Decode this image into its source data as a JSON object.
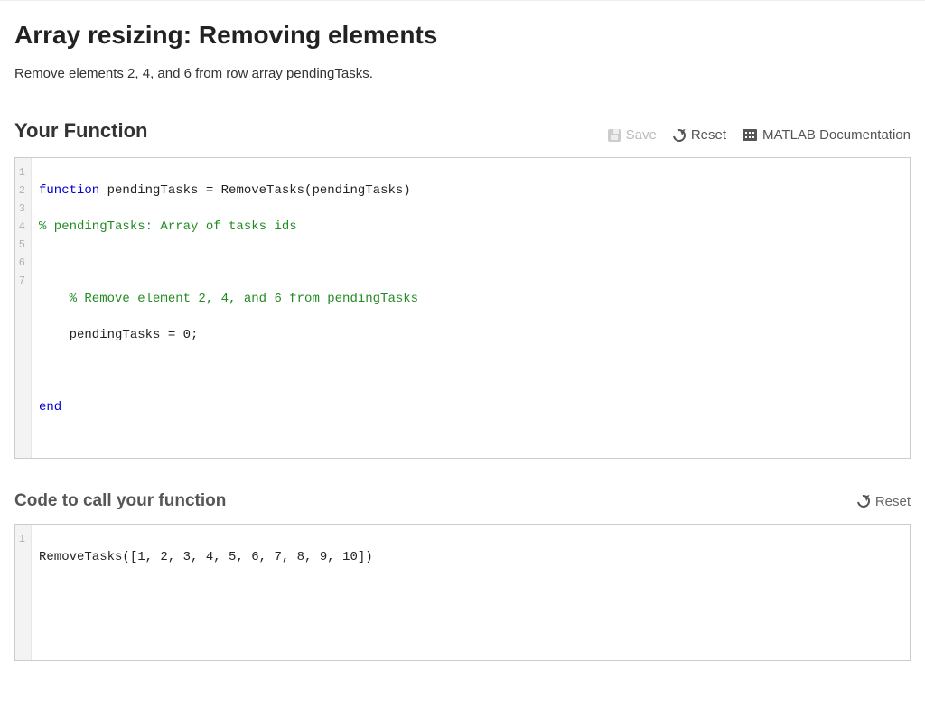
{
  "title": "Array resizing: Removing elements",
  "instruction": "Remove elements 2, 4, and 6 from row array pendingTasks.",
  "section1": {
    "heading": "Your Function",
    "actions": {
      "save": "Save",
      "reset": "Reset",
      "docs": "MATLAB Documentation"
    }
  },
  "editor1": {
    "gutter": [
      "1",
      "2",
      "3",
      "4",
      "5",
      "6",
      "7"
    ],
    "lines": {
      "l1a": "function",
      "l1b": " pendingTasks = RemoveTasks(pendingTasks)",
      "l2": "% pendingTasks: Array of tasks ids",
      "l3": "",
      "l4": "    % Remove element 2, 4, and 6 from pendingTasks",
      "l5": "    pendingTasks = 0;",
      "l6": "",
      "l7": "end"
    }
  },
  "section2": {
    "heading": "Code to call your function",
    "actions": {
      "reset": "Reset"
    }
  },
  "editor2": {
    "gutter": [
      "1"
    ],
    "lines": {
      "l1": "RemoveTasks([1, 2, 3, 4, 5, 6, 7, 8, 9, 10])"
    }
  }
}
